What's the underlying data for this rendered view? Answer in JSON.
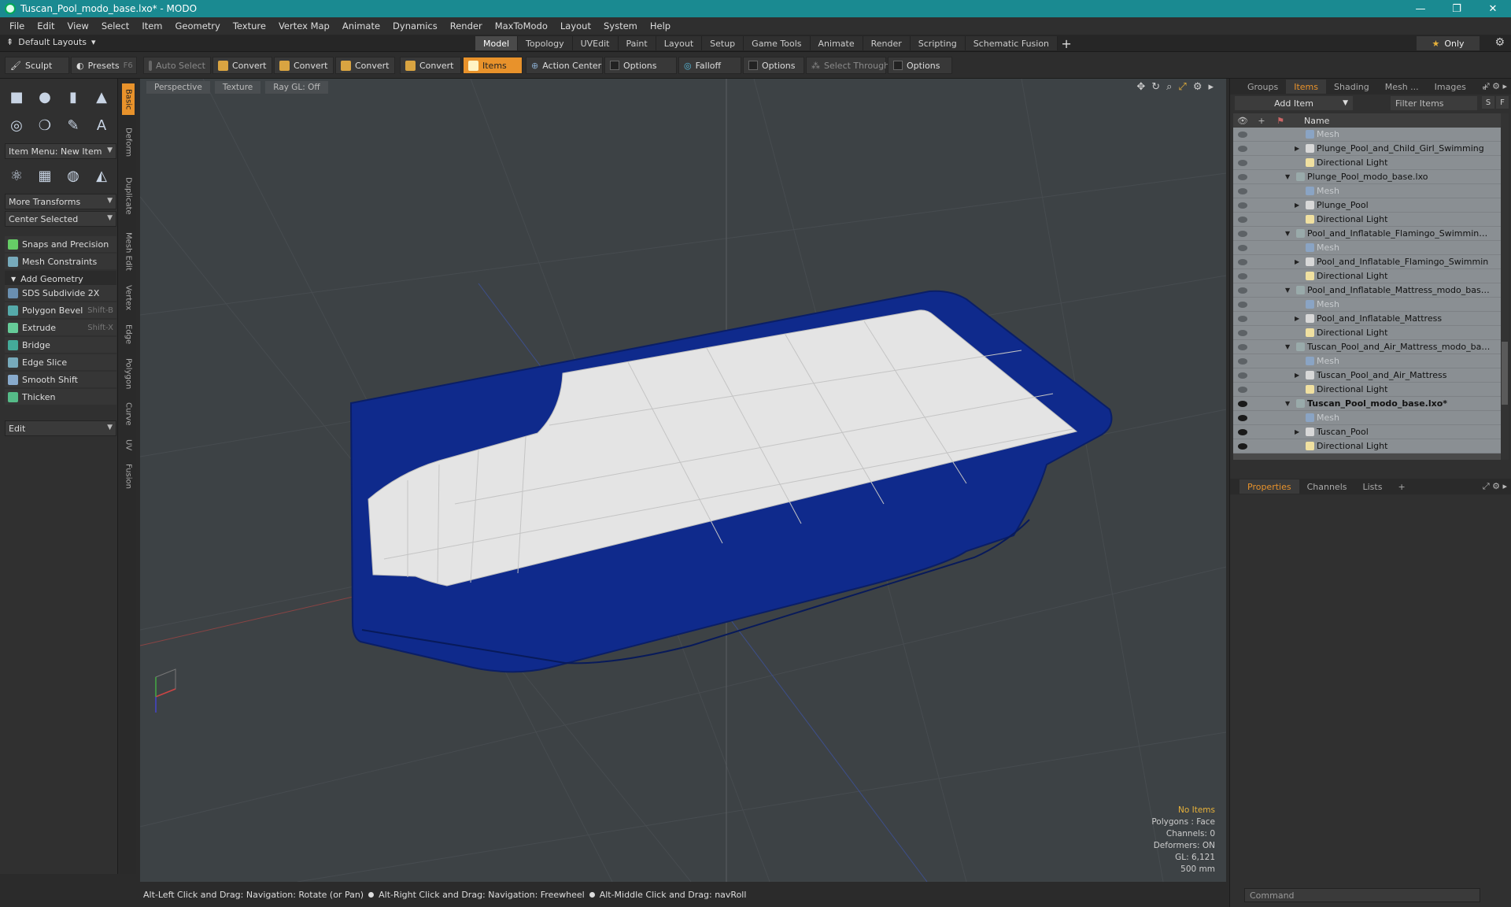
{
  "window": {
    "title": "Tuscan_Pool_modo_base.lxo* - MODO",
    "controls": [
      "—",
      "❐",
      "✕"
    ]
  },
  "menu": [
    "File",
    "Edit",
    "View",
    "Select",
    "Item",
    "Geometry",
    "Texture",
    "Vertex Map",
    "Animate",
    "Dynamics",
    "Render",
    "MaxToModo",
    "Layout",
    "System",
    "Help"
  ],
  "layout_bar": {
    "layouts_label": "Default Layouts",
    "tabs": [
      "Model",
      "Topology",
      "UVEdit",
      "Paint",
      "Layout",
      "Setup",
      "Game Tools",
      "Animate",
      "Render",
      "Scripting",
      "Schematic Fusion"
    ],
    "active_tab": "Model",
    "only_label": "Only"
  },
  "toolbar": {
    "sculpt": "Sculpt",
    "presets": "Presets",
    "presets_shortcut": "F6",
    "auto_select": "Auto Select",
    "convert1": "Convert",
    "convert2": "Convert",
    "convert3": "Convert",
    "convert4": "Convert",
    "items": "Items",
    "action_center": "Action Center",
    "options1": "Options",
    "falloff": "Falloff",
    "options2": "Options",
    "select_through": "Select Through",
    "options3": "Options"
  },
  "left_panel": {
    "item_menu": "Item Menu: New Item",
    "more_transforms": "More Transforms",
    "center_selected": "Center Selected",
    "snaps": "Snaps and Precision",
    "mesh_constraints": "Mesh Constraints",
    "add_geometry": "Add Geometry",
    "tools": [
      {
        "label": "SDS Subdivide 2X",
        "shortcut": ""
      },
      {
        "label": "Polygon Bevel",
        "shortcut": "Shift-B"
      },
      {
        "label": "Extrude",
        "shortcut": "Shift-X"
      },
      {
        "label": "Bridge",
        "shortcut": ""
      },
      {
        "label": "Edge Slice",
        "shortcut": ""
      },
      {
        "label": "Smooth Shift",
        "shortcut": ""
      },
      {
        "label": "Thicken",
        "shortcut": ""
      }
    ],
    "edit": "Edit"
  },
  "side_tabs": [
    "Basic",
    "Deform",
    "Duplicate",
    "Mesh Edit",
    "Vertex",
    "Edge",
    "Polygon",
    "Curve",
    "UV",
    "Fusion"
  ],
  "viewport": {
    "tabs": [
      "Perspective",
      "Texture",
      "Ray GL: Off"
    ],
    "info": {
      "selection": "No Items",
      "polygons": "Polygons : Face",
      "channels": "Channels: 0",
      "deformers": "Deformers: ON",
      "gl": "GL: 6,121",
      "scale": "500 mm"
    },
    "colors": {
      "background": "#3d4245",
      "pool_shell": "#0f2a8c",
      "pool_surface": "#e4e4e4"
    }
  },
  "status_bar": {
    "hint1": "Alt-Left Click and Drag: Navigation: Rotate (or Pan)",
    "hint2": "Alt-Right Click and Drag: Navigation: Freewheel",
    "hint3": "Alt-Middle Click and Drag: navRoll"
  },
  "right_panel": {
    "top_tabs": [
      "Groups",
      "Items",
      "Shading",
      "Mesh ...",
      "Images"
    ],
    "active_top_tab": "Items",
    "add_item": "Add Item",
    "filter_items": "Filter Items",
    "btn_s": "S",
    "btn_f": "F",
    "name_header": "Name",
    "tree": [
      {
        "label": "Mesh",
        "depth": 2,
        "kind": "mesh",
        "dim": true,
        "eye": false
      },
      {
        "label": "Plunge_Pool_and_Child_Girl_Swimming",
        "depth": 2,
        "kind": "item",
        "arrow": "▶",
        "eye": false
      },
      {
        "label": "Directional Light",
        "depth": 2,
        "kind": "light",
        "eye": false
      },
      {
        "label": "Plunge_Pool_modo_base.lxo",
        "depth": 1,
        "kind": "scene",
        "arrow": "▼",
        "eye": false
      },
      {
        "label": "Mesh",
        "depth": 2,
        "kind": "mesh",
        "dim": true,
        "eye": false
      },
      {
        "label": "Plunge_Pool",
        "depth": 2,
        "kind": "item",
        "arrow": "▶",
        "eye": false
      },
      {
        "label": "Directional Light",
        "depth": 2,
        "kind": "light",
        "eye": false
      },
      {
        "label": "Pool_and_Inflatable_Flamingo_Swimming_ ...",
        "depth": 1,
        "kind": "scene",
        "arrow": "▼",
        "eye": false
      },
      {
        "label": "Mesh",
        "depth": 2,
        "kind": "mesh",
        "dim": true,
        "eye": false
      },
      {
        "label": "Pool_and_Inflatable_Flamingo_Swimmin",
        "depth": 2,
        "kind": "item",
        "arrow": "▶",
        "eye": false
      },
      {
        "label": "Directional Light",
        "depth": 2,
        "kind": "light",
        "eye": false
      },
      {
        "label": "Pool_and_Inflatable_Mattress_modo_base ...",
        "depth": 1,
        "kind": "scene",
        "arrow": "▼",
        "eye": false
      },
      {
        "label": "Mesh",
        "depth": 2,
        "kind": "mesh",
        "dim": true,
        "eye": false
      },
      {
        "label": "Pool_and_Inflatable_Mattress",
        "depth": 2,
        "kind": "item",
        "arrow": "▶",
        "eye": false
      },
      {
        "label": "Directional Light",
        "depth": 2,
        "kind": "light",
        "eye": false
      },
      {
        "label": "Tuscan_Pool_and_Air_Mattress_modo_baS...",
        "depth": 1,
        "kind": "scene",
        "arrow": "▼",
        "eye": false
      },
      {
        "label": "Mesh",
        "depth": 2,
        "kind": "mesh",
        "dim": true,
        "eye": false
      },
      {
        "label": "Tuscan_Pool_and_Air_Mattress",
        "depth": 2,
        "kind": "item",
        "arrow": "▶",
        "eye": false
      },
      {
        "label": "Directional Light",
        "depth": 2,
        "kind": "light",
        "eye": false
      },
      {
        "label": "Tuscan_Pool_modo_base.lxo*",
        "depth": 1,
        "kind": "scene",
        "arrow": "▼",
        "bold": true,
        "eye": true
      },
      {
        "label": "Mesh",
        "depth": 2,
        "kind": "mesh",
        "dim": true,
        "eye": true
      },
      {
        "label": "Tuscan_Pool",
        "depth": 2,
        "kind": "item",
        "arrow": "▶",
        "eye": true
      },
      {
        "label": "Directional Light",
        "depth": 2,
        "kind": "light",
        "eye": true
      }
    ],
    "bottom_tabs": [
      "Properties",
      "Channels",
      "Lists"
    ],
    "active_bottom_tab": "Properties",
    "command_placeholder": "Command"
  }
}
